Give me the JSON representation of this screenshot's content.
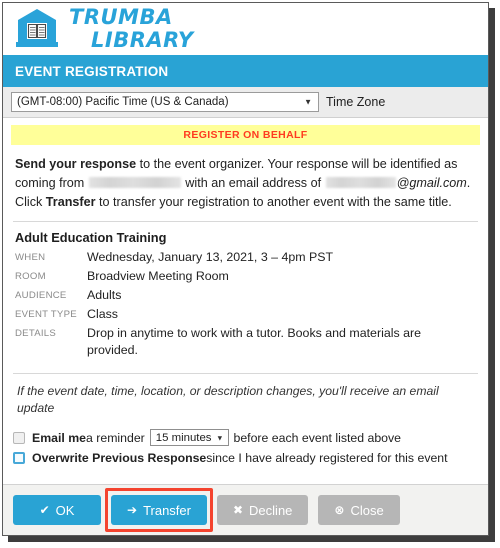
{
  "logo": {
    "line1": "TRUMBA",
    "line2": "LIBRARY",
    "icon": "library-building-book-icon",
    "color": "#29a3d9"
  },
  "header": {
    "title": "EVENT REGISTRATION",
    "background": "#29a3d4"
  },
  "timezone": {
    "selected": "(GMT-08:00) Pacific Time (US & Canada)",
    "label": "Time Zone",
    "caret": "▼"
  },
  "notice": {
    "text": "REGISTER ON BEHALF",
    "background": "#ffff99",
    "color": "#ff3b20"
  },
  "intro": {
    "lead": "Send your response",
    "part1": " to the event organizer. Your response will be identified as coming from ",
    "part2": " with an email address of ",
    "email_domain": "@gmail.com",
    "period": ".",
    "part3": "Click ",
    "transfer_word": "Transfer",
    "part4": " to transfer your registration to another event with the same title.",
    "redacted_name": "",
    "redacted_email": ""
  },
  "event": {
    "title": "Adult Education Training",
    "rows": [
      {
        "key": "WHEN",
        "value": "Wednesday, January 13, 2021, 3 – 4pm PST"
      },
      {
        "key": "ROOM",
        "value": "Broadview Meeting Room"
      },
      {
        "key": "AUDIENCE",
        "value": "Adults"
      },
      {
        "key": "EVENT TYPE",
        "value": "Class"
      },
      {
        "key": "DETAILS",
        "value": "Drop in anytime to work with a tutor. Books and materials are provided."
      }
    ]
  },
  "update_note": {
    "text": "If the event date, time, location, or description changes, you'll receive an email update"
  },
  "options": {
    "reminder": {
      "label_bold": "Email me",
      "label_rest": " a reminder",
      "select_value": "15 minutes",
      "caret": "▼",
      "suffix": "before each event listed above",
      "checked": false
    },
    "overwrite": {
      "label_bold": "Overwrite Previous Response",
      "label_rest": " since I have already registered for this event",
      "checked": false,
      "focused": true
    }
  },
  "footer": {
    "buttons": [
      {
        "name": "ok",
        "label": "OK",
        "icon": "check-icon",
        "glyph": "✔",
        "style": "primary",
        "highlighted": false
      },
      {
        "name": "transfer",
        "label": "Transfer",
        "icon": "arrow-right-icon",
        "glyph": "➔",
        "style": "primary",
        "highlighted": true
      },
      {
        "name": "decline",
        "label": "Decline",
        "icon": "x-icon",
        "glyph": "✖",
        "style": "muted",
        "highlighted": false
      },
      {
        "name": "close",
        "label": "Close",
        "icon": "circle-x-icon",
        "glyph": "⊗",
        "style": "muted",
        "highlighted": false
      }
    ],
    "highlight_color": "#f4432e"
  }
}
